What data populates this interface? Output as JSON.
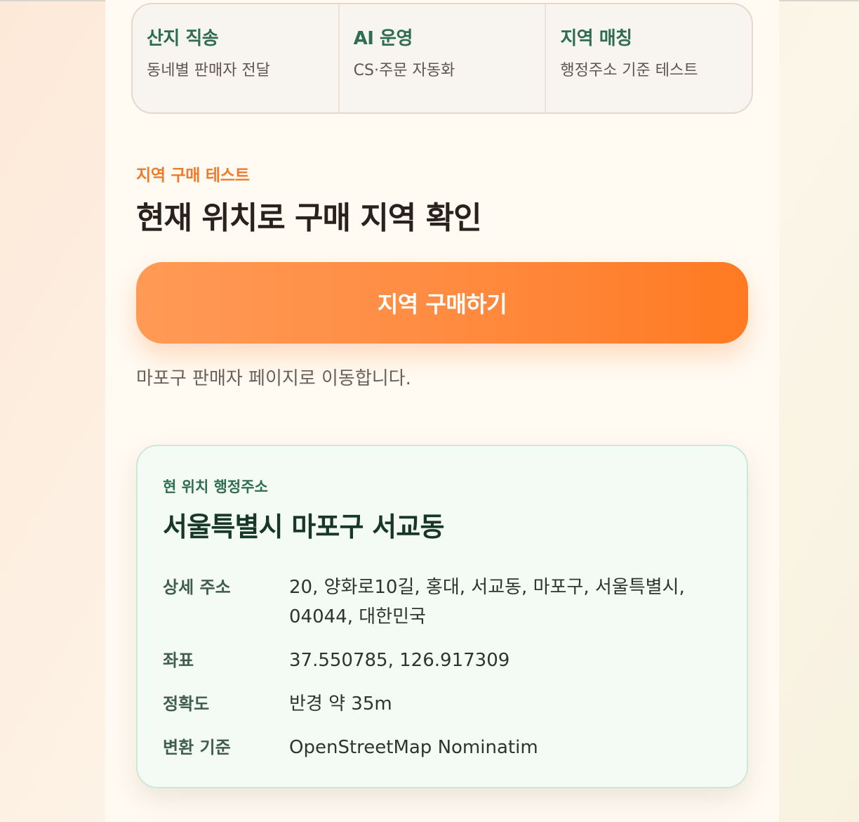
{
  "features": [
    {
      "title": "산지 직송",
      "desc": "동네별 판매자 전달"
    },
    {
      "title": "AI 운영",
      "desc": "CS·주문 자동화"
    },
    {
      "title": "지역 매칭",
      "desc": "행정주소 기준 테스트"
    }
  ],
  "section": {
    "eyebrow": "지역 구매 테스트",
    "title": "현재 위치로 구매 지역 확인",
    "cta_label": "지역 구매하기",
    "hint": "마포구 판매자 페이지로 이동합니다."
  },
  "location": {
    "eyebrow": "현 위치 행정주소",
    "title": "서울특별시 마포구 서교동",
    "rows": [
      {
        "label": "상세 주소",
        "value": "20, 양화로10길, 홍대, 서교동, 마포구, 서울특별시, 04044, 대한민국"
      },
      {
        "label": "좌표",
        "value": "37.550785, 126.917309"
      },
      {
        "label": "정확도",
        "value": "반경 약 35m"
      },
      {
        "label": "변환 기준",
        "value": "OpenStreetMap Nominatim"
      }
    ]
  },
  "colors": {
    "accent_orange": "#ff8a3f",
    "feature_green": "#2e6d4f",
    "card_bg": "#f3fbf4"
  }
}
